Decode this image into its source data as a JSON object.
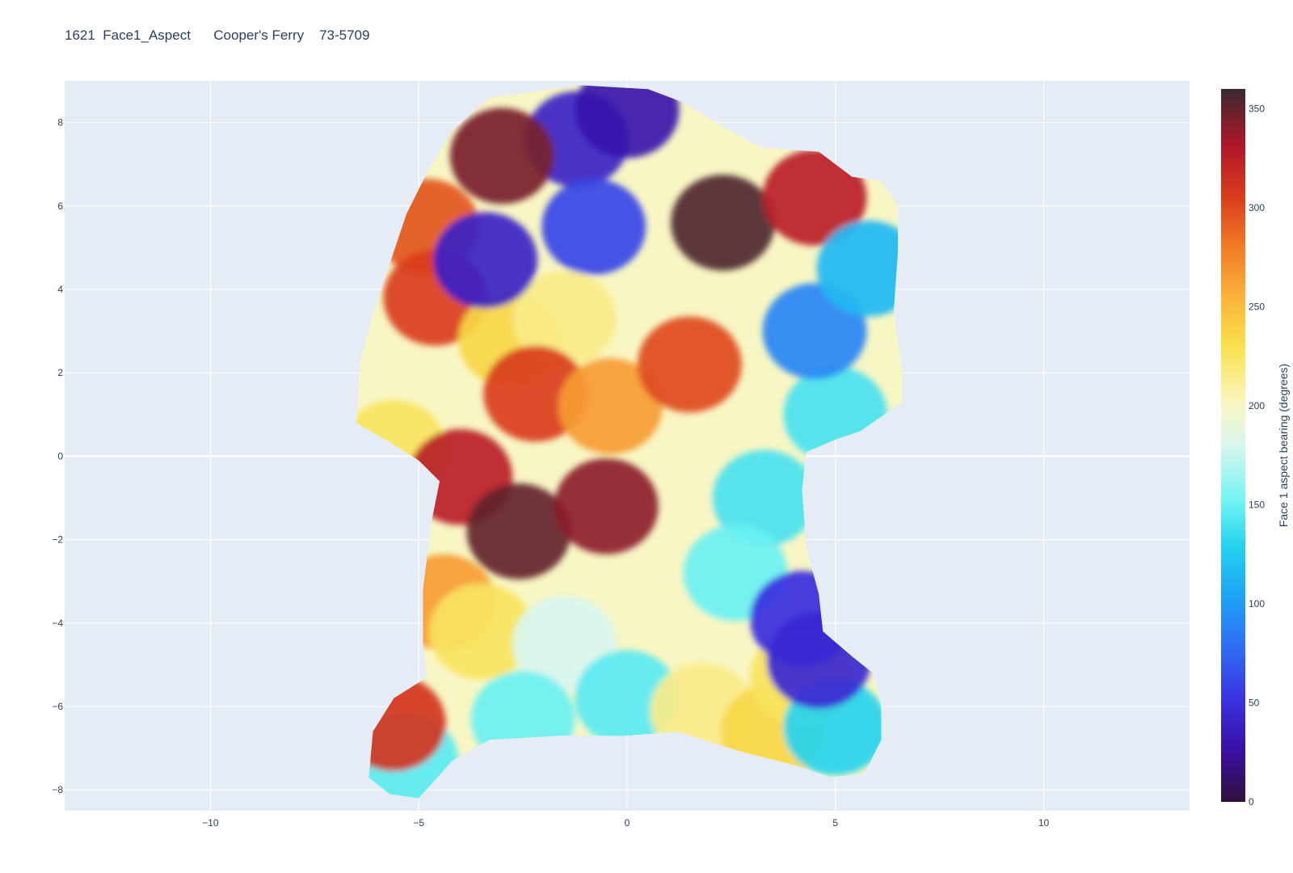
{
  "title": "1621  Face1_Aspect      Cooper's Ferry    73-5709",
  "chart_data": {
    "type": "heatmap",
    "title": "1621  Face1_Aspect      Cooper's Ferry    73-5709",
    "xlabel": "",
    "ylabel": "",
    "xlim": [
      -13.5,
      13.5
    ],
    "ylim": [
      -8.5,
      9
    ],
    "xticks": [
      -10,
      -5,
      0,
      5,
      10
    ],
    "xtick_labels": [
      "−10",
      "−5",
      "0",
      "5",
      "10"
    ],
    "yticks": [
      8,
      6,
      4,
      2,
      0,
      -2,
      -4,
      -6,
      -8
    ],
    "ytick_labels": [
      "8",
      "6",
      "4",
      "2",
      "0",
      "−2",
      "−4",
      "−6",
      "−8"
    ],
    "grid": true,
    "colorbar": {
      "title": "Face 1 aspect bearing (degrees)",
      "range": [
        0,
        360
      ],
      "ticks": [
        0,
        50,
        100,
        150,
        200,
        250,
        300,
        350
      ],
      "colorscale": [
        [
          0.0,
          "#30123b"
        ],
        [
          0.07,
          "#3a0fa0"
        ],
        [
          0.14,
          "#3b2fe0"
        ],
        [
          0.22,
          "#2f6ff5"
        ],
        [
          0.29,
          "#1ea4f5"
        ],
        [
          0.36,
          "#25d3ee"
        ],
        [
          0.42,
          "#6ff3f3"
        ],
        [
          0.5,
          "#d8f6f0"
        ],
        [
          0.56,
          "#fbf6c0"
        ],
        [
          0.64,
          "#f9e04a"
        ],
        [
          0.71,
          "#fbb13a"
        ],
        [
          0.78,
          "#f17a26"
        ],
        [
          0.85,
          "#d93b1c"
        ],
        [
          0.92,
          "#b0162a"
        ],
        [
          1.0,
          "#3a2a30"
        ]
      ]
    },
    "outline": [
      [
        -3.3,
        8.6
      ],
      [
        -2.5,
        8.7
      ],
      [
        -1.2,
        8.9
      ],
      [
        0.5,
        8.8
      ],
      [
        1.3,
        8.5
      ],
      [
        2.3,
        7.9
      ],
      [
        3.2,
        7.4
      ],
      [
        4.6,
        7.3
      ],
      [
        5.0,
        7.0
      ],
      [
        5.4,
        6.7
      ],
      [
        6.1,
        6.6
      ],
      [
        6.5,
        6.0
      ],
      [
        6.5,
        4.9
      ],
      [
        6.4,
        3.5
      ],
      [
        6.6,
        2.0
      ],
      [
        6.6,
        1.3
      ],
      [
        5.6,
        0.6
      ],
      [
        5.0,
        0.4
      ],
      [
        4.3,
        0.1
      ],
      [
        4.2,
        -0.8
      ],
      [
        4.3,
        -2.2
      ],
      [
        4.6,
        -3.3
      ],
      [
        4.7,
        -4.2
      ],
      [
        5.4,
        -4.8
      ],
      [
        5.9,
        -5.2
      ],
      [
        6.1,
        -6.0
      ],
      [
        6.1,
        -6.8
      ],
      [
        5.7,
        -7.6
      ],
      [
        4.9,
        -7.7
      ],
      [
        4.0,
        -7.4
      ],
      [
        2.8,
        -7.1
      ],
      [
        1.2,
        -6.6
      ],
      [
        0.0,
        -6.7
      ],
      [
        -1.6,
        -6.7
      ],
      [
        -3.3,
        -6.8
      ],
      [
        -4.2,
        -7.3
      ],
      [
        -5.0,
        -8.2
      ],
      [
        -5.7,
        -8.1
      ],
      [
        -6.2,
        -7.7
      ],
      [
        -6.1,
        -6.6
      ],
      [
        -5.6,
        -5.8
      ],
      [
        -4.8,
        -5.3
      ],
      [
        -4.9,
        -4.5
      ],
      [
        -4.9,
        -3.2
      ],
      [
        -4.7,
        -1.6
      ],
      [
        -4.5,
        -0.6
      ],
      [
        -5.0,
        -0.1
      ],
      [
        -5.8,
        0.4
      ],
      [
        -6.5,
        0.8
      ],
      [
        -6.4,
        2.3
      ],
      [
        -6.1,
        3.4
      ],
      [
        -5.7,
        4.6
      ],
      [
        -5.3,
        5.8
      ],
      [
        -4.8,
        6.8
      ],
      [
        -4.2,
        7.8
      ]
    ],
    "aspect_regions": [
      {
        "center": [
          -1.2,
          7.6
        ],
        "value": 40
      },
      {
        "center": [
          0.0,
          8.3
        ],
        "value": 30
      },
      {
        "center": [
          -0.8,
          5.5
        ],
        "value": 60
      },
      {
        "center": [
          -3.0,
          7.2
        ],
        "value": 345
      },
      {
        "center": [
          2.3,
          5.6
        ],
        "value": 355
      },
      {
        "center": [
          4.5,
          6.2
        ],
        "value": 325
      },
      {
        "center": [
          -4.8,
          5.5
        ],
        "value": 295
      },
      {
        "center": [
          -4.6,
          3.8
        ],
        "value": 305
      },
      {
        "center": [
          -2.8,
          2.8
        ],
        "value": 235
      },
      {
        "center": [
          -1.5,
          3.3
        ],
        "value": 215
      },
      {
        "center": [
          -2.2,
          1.5
        ],
        "value": 305
      },
      {
        "center": [
          -0.4,
          1.2
        ],
        "value": 265
      },
      {
        "center": [
          1.5,
          2.2
        ],
        "value": 300
      },
      {
        "center": [
          -5.6,
          0.2
        ],
        "value": 225
      },
      {
        "center": [
          -4.0,
          -0.5
        ],
        "value": 325
      },
      {
        "center": [
          -2.6,
          -1.8
        ],
        "value": 350
      },
      {
        "center": [
          -0.5,
          -1.2
        ],
        "value": 340
      },
      {
        "center": [
          -4.4,
          -3.5
        ],
        "value": 265
      },
      {
        "center": [
          -3.5,
          -4.2
        ],
        "value": 225
      },
      {
        "center": [
          -1.5,
          -4.5
        ],
        "value": 180
      },
      {
        "center": [
          -2.5,
          -6.3
        ],
        "value": 150
      },
      {
        "center": [
          0.0,
          -5.8
        ],
        "value": 145
      },
      {
        "center": [
          1.8,
          -6.1
        ],
        "value": 215
      },
      {
        "center": [
          3.5,
          -6.6
        ],
        "value": 235
      },
      {
        "center": [
          4.2,
          -5.3
        ],
        "value": 225
      },
      {
        "center": [
          5.0,
          -6.5
        ],
        "value": 130
      },
      {
        "center": [
          5.0,
          1.0
        ],
        "value": 140
      },
      {
        "center": [
          3.3,
          -1.0
        ],
        "value": 140
      },
      {
        "center": [
          4.5,
          3.0
        ],
        "value": 90
      },
      {
        "center": [
          5.8,
          4.5
        ],
        "value": 115
      },
      {
        "center": [
          2.6,
          -2.8
        ],
        "value": 150
      },
      {
        "center": [
          4.2,
          -3.9
        ],
        "value": 50
      },
      {
        "center": [
          4.6,
          -4.9
        ],
        "value": 45
      },
      {
        "center": [
          -5.3,
          -7.3
        ],
        "value": 145
      },
      {
        "center": [
          -5.6,
          -6.4
        ],
        "value": 310
      },
      {
        "center": [
          -3.4,
          4.7
        ],
        "value": 40
      }
    ]
  }
}
